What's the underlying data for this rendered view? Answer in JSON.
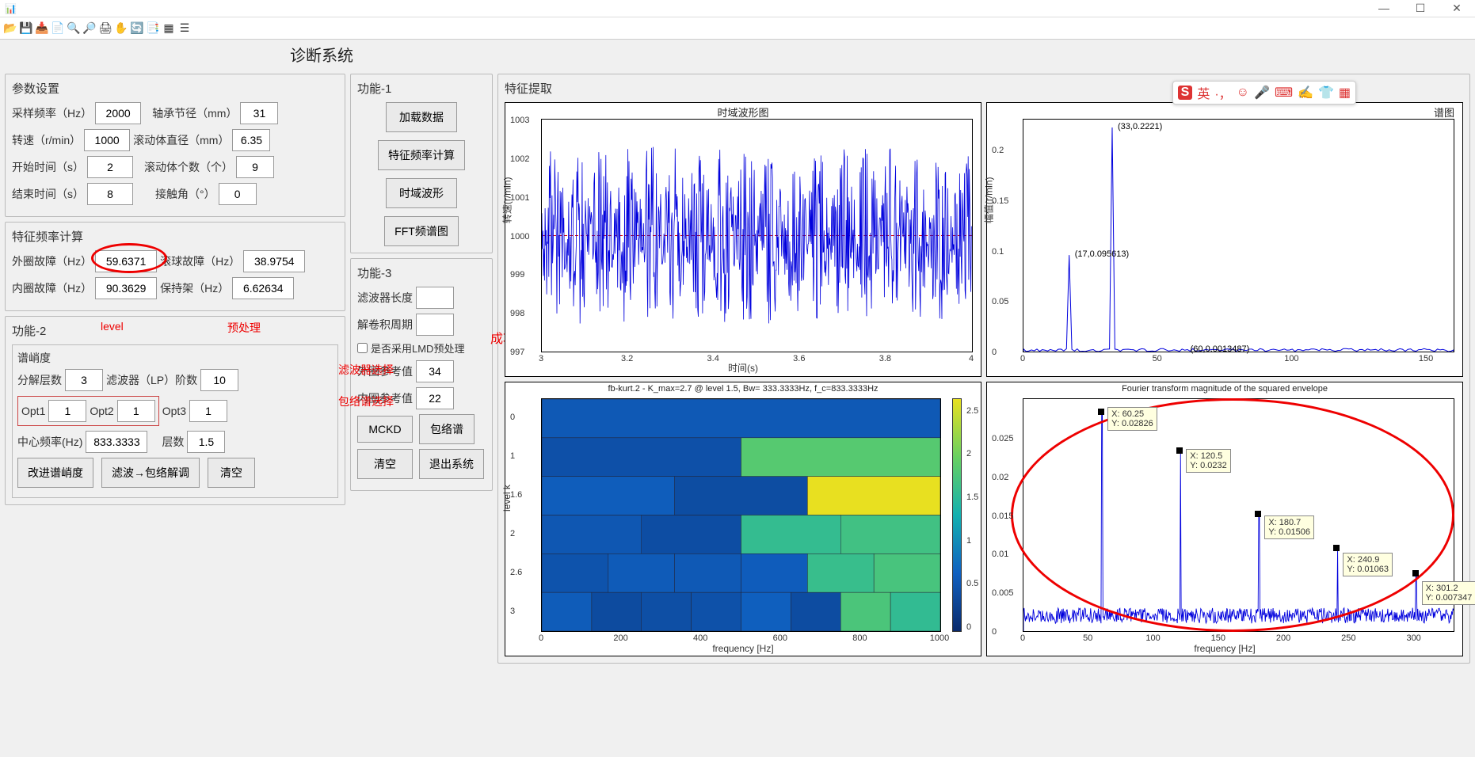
{
  "window": {
    "dash": "—",
    "min": "—",
    "max": "☐",
    "close": "✕"
  },
  "app_title_suffix": "诊断系统",
  "toolbar_icons": [
    "folder-open",
    "save",
    "import",
    "save-as",
    "zoom-in",
    "zoom-out",
    "print",
    "hand",
    "rotate",
    "data-cursor",
    "grid",
    "colorbar"
  ],
  "params_panel": {
    "title": "参数设置",
    "sample_rate_lbl": "采样频率（Hz）",
    "sample_rate": "2000",
    "pitch_dia_lbl": "轴承节径（mm）",
    "pitch_dia": "31",
    "speed_lbl": "转速（r/min）",
    "speed": "1000",
    "roll_dia_lbl": "滚动体直径（mm）",
    "roll_dia": "6.35",
    "start_time_lbl": "开始时间（s）",
    "start_time": "2",
    "roll_count_lbl": "滚动体个数（个）",
    "roll_count": "9",
    "end_time_lbl": "结束时间（s）",
    "end_time": "8",
    "contact_angle_lbl": "接触角（°）",
    "contact_angle": "0"
  },
  "charfreq_panel": {
    "title": "特征频率计算",
    "outer_lbl": "外圈故障（Hz）",
    "outer": "59.6371",
    "roll_lbl": "滚球故障（Hz）",
    "roll": "38.9754",
    "inner_lbl": "内圈故障（Hz）",
    "inner": "90.3629",
    "cage_lbl": "保持架（Hz）",
    "cage": "6.62634"
  },
  "func2_panel": {
    "title": "功能-2",
    "subtitle": "谱峭度",
    "level_ann": "level",
    "prep_ann": "预处理",
    "filtsel_ann": "滤波器选择",
    "envsel_ann": "包络谱选择",
    "decomp_lbl": "分解层数",
    "decomp": "3",
    "lpord_lbl": "滤波器（LP）阶数",
    "lpord": "10",
    "opt1_lbl": "Opt1",
    "opt1": "1",
    "opt2_lbl": "Opt2",
    "opt2": "1",
    "opt3_lbl": "Opt3",
    "opt3": "1",
    "centerf_lbl": "中心频率(Hz)",
    "centerf": "833.3333",
    "layers_lbl": "层数",
    "layers": "1.5",
    "btn_impkurt": "改进谱峭度",
    "btn_filtenv": "滤波→包络解调",
    "btn_clear": "清空"
  },
  "func1_panel": {
    "title": "功能-1",
    "btn_load": "加载数据",
    "btn_charfreq": "特征频率计算",
    "btn_timewave": "时域波形",
    "btn_fft": "FFT频谱图"
  },
  "func3_panel": {
    "title": "功能-3",
    "filtlen_lbl": "滤波器长度",
    "filtlen": "",
    "deconv_lbl": "解卷积周期",
    "deconv": "",
    "lmd_chk": "是否采用LMD预处理",
    "outer_ref_lbl": "外圈参考值",
    "outer_ref": "34",
    "inner_ref_lbl": "内圈参考值",
    "inner_ref": "22",
    "btn_mckd": "MCKD",
    "btn_env": "包络谱",
    "btn_clear": "清空",
    "btn_exit": "退出系统"
  },
  "feat_extract_title": "特征提取",
  "success_ann": "成功提取！！！",
  "ime": {
    "s": "S",
    "lang": "英"
  },
  "chart_data": [
    {
      "id": "time_waveform",
      "type": "line",
      "title": "时域波形图",
      "xlabel": "时间(s)",
      "ylabel": "转速(r/min)",
      "x_ticks": [
        3,
        3.2,
        3.4,
        3.6,
        3.8,
        4
      ],
      "y_ticks": [
        997,
        998,
        999,
        1000,
        1001,
        1002,
        1003
      ],
      "xlim": [
        3,
        4
      ],
      "ylim": [
        997,
        1003
      ],
      "note": "dense noisy oscillation around 1000 with red dashed mean line at y=1000"
    },
    {
      "id": "spectrum",
      "type": "line",
      "title": "谱图",
      "xlabel": "",
      "ylabel": "幅值(r/min)",
      "x_ticks": [
        0,
        50,
        100,
        150
      ],
      "y_ticks": [
        0,
        0.05,
        0.1,
        0.15,
        0.2
      ],
      "xlim": [
        0,
        160
      ],
      "ylim": [
        0,
        0.23
      ],
      "annotations": [
        {
          "x": 33,
          "y": 0.2221,
          "label": "(33,0.2221)"
        },
        {
          "x": 17,
          "y": 0.095613,
          "label": "(17,0.095613)"
        },
        {
          "x": 60,
          "y": 0.0013487,
          "label": "(60,0.0013487)"
        }
      ]
    },
    {
      "id": "kurtogram",
      "type": "heatmap",
      "title": "fb-kurt.2 - K_max=2.7 @ level 1.5, Bw= 333.3333Hz, f_c=833.3333Hz",
      "xlabel": "frequency [Hz]",
      "ylabel": "level k",
      "x_ticks": [
        0,
        200,
        400,
        600,
        800,
        1000
      ],
      "y_levels": [
        0,
        1,
        1.6,
        2,
        2.6,
        3
      ],
      "xlim": [
        0,
        1000
      ],
      "colorbar_ticks": [
        0,
        0.5,
        1,
        1.5,
        2,
        2.5
      ],
      "max_cell": {
        "level": 1.5,
        "f_center": 833.3333,
        "value": 2.7
      }
    },
    {
      "id": "envelope",
      "type": "line",
      "title": "Fourier transform magnitude of the squared envelope",
      "xlabel": "frequency [Hz]",
      "ylabel": "",
      "x_ticks": [
        0,
        50,
        100,
        150,
        200,
        250,
        300
      ],
      "y_ticks": [
        0,
        0.005,
        0.01,
        0.015,
        0.02,
        0.025
      ],
      "xlim": [
        0,
        330
      ],
      "ylim": [
        0,
        0.03
      ],
      "datatips": [
        {
          "x": 60.25,
          "y": 0.02826
        },
        {
          "x": 120.5,
          "y": 0.0232
        },
        {
          "x": 180.7,
          "y": 0.01506
        },
        {
          "x": 240.9,
          "y": 0.01063
        },
        {
          "x": 301.2,
          "y": 0.007347
        }
      ]
    }
  ]
}
